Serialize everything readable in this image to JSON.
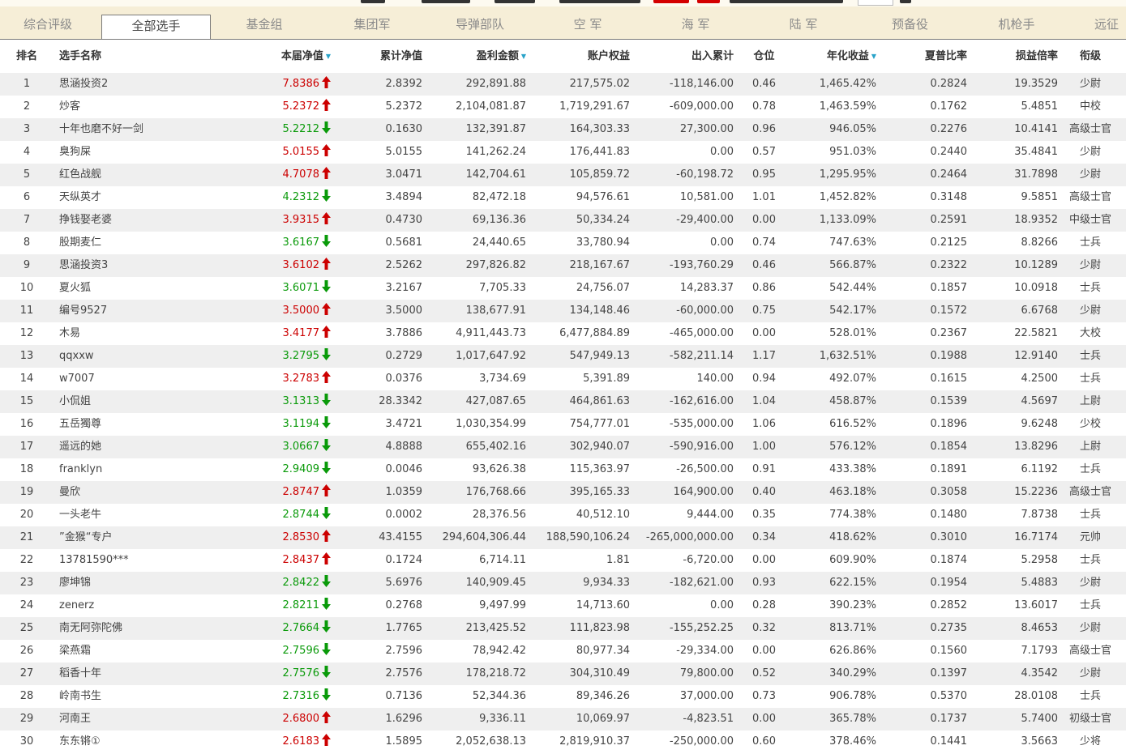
{
  "colors": {
    "up": "#cc0000",
    "down": "#0a9a0a",
    "sort": "#29a3c9",
    "tabbar": "#f6eed7",
    "row_alt": "#efefef"
  },
  "tabs": [
    {
      "label": "综合评级"
    },
    {
      "label": "全部选手",
      "active": true
    },
    {
      "label": "基金组"
    },
    {
      "label": "集团军"
    },
    {
      "label": "导弹部队"
    },
    {
      "label": "空 军"
    },
    {
      "label": "海 军"
    },
    {
      "label": "陆 军"
    },
    {
      "label": "预备役"
    },
    {
      "label": "机枪手"
    },
    {
      "label": "远征"
    }
  ],
  "table": {
    "headers": {
      "rank": "排名",
      "name": "选手名称",
      "nav": "本届净值",
      "cum_nav": "累计净值",
      "profit": "盈利金额",
      "equity": "账户权益",
      "inout": "出入累计",
      "position": "仓位",
      "annual": "年化收益",
      "sharpe": "夏普比率",
      "pl_ratio": "损益倍率",
      "military_rank": "衔级"
    },
    "sort_icon": "triangle-down-icon",
    "rows": [
      {
        "rank": "1",
        "name": "思涵投资2",
        "nav": "7.8386",
        "dir": "up",
        "cum_nav": "2.8392",
        "profit": "292,891.88",
        "equity": "217,575.02",
        "inout": "-118,146.00",
        "position": "0.46",
        "annual": "1,465.42%",
        "sharpe": "0.2824",
        "pl": "19.3529",
        "mrank": "少尉"
      },
      {
        "rank": "2",
        "name": "炒客",
        "nav": "5.2372",
        "dir": "up",
        "cum_nav": "5.2372",
        "profit": "2,104,081.87",
        "equity": "1,719,291.67",
        "inout": "-609,000.00",
        "position": "0.78",
        "annual": "1,463.59%",
        "sharpe": "0.1762",
        "pl": "5.4851",
        "mrank": "中校"
      },
      {
        "rank": "3",
        "name": "十年也磨不好一剑",
        "nav": "5.2212",
        "dir": "down",
        "cum_nav": "0.1630",
        "profit": "132,391.87",
        "equity": "164,303.33",
        "inout": "27,300.00",
        "position": "0.96",
        "annual": "946.05%",
        "sharpe": "0.2276",
        "pl": "10.4141",
        "mrank": "高级士官"
      },
      {
        "rank": "4",
        "name": "臭狗屎",
        "nav": "5.0155",
        "dir": "up",
        "cum_nav": "5.0155",
        "profit": "141,262.24",
        "equity": "176,441.83",
        "inout": "0.00",
        "position": "0.57",
        "annual": "951.03%",
        "sharpe": "0.2440",
        "pl": "35.4841",
        "mrank": "少尉"
      },
      {
        "rank": "5",
        "name": "红色战舰",
        "nav": "4.7078",
        "dir": "up",
        "cum_nav": "3.0471",
        "profit": "142,704.61",
        "equity": "105,859.72",
        "inout": "-60,198.72",
        "position": "0.95",
        "annual": "1,295.95%",
        "sharpe": "0.2464",
        "pl": "31.7898",
        "mrank": "少尉"
      },
      {
        "rank": "6",
        "name": "天纵英才",
        "nav": "4.2312",
        "dir": "down",
        "cum_nav": "3.4894",
        "profit": "82,472.18",
        "equity": "94,576.61",
        "inout": "10,581.00",
        "position": "1.01",
        "annual": "1,452.82%",
        "sharpe": "0.3148",
        "pl": "9.5851",
        "mrank": "高级士官"
      },
      {
        "rank": "7",
        "name": "挣钱娶老婆",
        "nav": "3.9315",
        "dir": "up",
        "cum_nav": "0.4730",
        "profit": "69,136.36",
        "equity": "50,334.24",
        "inout": "-29,400.00",
        "position": "0.00",
        "annual": "1,133.09%",
        "sharpe": "0.2591",
        "pl": "18.9352",
        "mrank": "中级士官"
      },
      {
        "rank": "8",
        "name": "股期麦仁",
        "nav": "3.6167",
        "dir": "down",
        "cum_nav": "0.5681",
        "profit": "24,440.65",
        "equity": "33,780.94",
        "inout": "0.00",
        "position": "0.74",
        "annual": "747.63%",
        "sharpe": "0.2125",
        "pl": "8.8266",
        "mrank": "士兵"
      },
      {
        "rank": "9",
        "name": "思涵投资3",
        "nav": "3.6102",
        "dir": "up",
        "cum_nav": "2.5262",
        "profit": "297,826.82",
        "equity": "218,167.67",
        "inout": "-193,760.29",
        "position": "0.46",
        "annual": "566.87%",
        "sharpe": "0.2322",
        "pl": "10.1289",
        "mrank": "少尉"
      },
      {
        "rank": "10",
        "name": "夏火狐",
        "nav": "3.6071",
        "dir": "down",
        "cum_nav": "3.2167",
        "profit": "7,705.33",
        "equity": "24,756.07",
        "inout": "14,283.37",
        "position": "0.86",
        "annual": "542.44%",
        "sharpe": "0.1857",
        "pl": "10.0918",
        "mrank": "士兵"
      },
      {
        "rank": "11",
        "name": "编号9527",
        "nav": "3.5000",
        "dir": "up",
        "cum_nav": "3.5000",
        "profit": "138,677.91",
        "equity": "134,148.46",
        "inout": "-60,000.00",
        "position": "0.75",
        "annual": "542.17%",
        "sharpe": "0.1572",
        "pl": "6.6768",
        "mrank": "少尉"
      },
      {
        "rank": "12",
        "name": "木易",
        "nav": "3.4177",
        "dir": "up",
        "cum_nav": "3.7886",
        "profit": "4,911,443.73",
        "equity": "6,477,884.89",
        "inout": "-465,000.00",
        "position": "0.00",
        "annual": "528.01%",
        "sharpe": "0.2367",
        "pl": "22.5821",
        "mrank": "大校"
      },
      {
        "rank": "13",
        "name": "qqxxw",
        "nav": "3.2795",
        "dir": "down",
        "cum_nav": "0.2729",
        "profit": "1,017,647.92",
        "equity": "547,949.13",
        "inout": "-582,211.14",
        "position": "1.17",
        "annual": "1,632.51%",
        "sharpe": "0.1988",
        "pl": "12.9140",
        "mrank": "士兵"
      },
      {
        "rank": "14",
        "name": "w7007",
        "nav": "3.2783",
        "dir": "up",
        "cum_nav": "0.0376",
        "profit": "3,734.69",
        "equity": "5,391.89",
        "inout": "140.00",
        "position": "0.94",
        "annual": "492.07%",
        "sharpe": "0.1615",
        "pl": "4.2500",
        "mrank": "士兵"
      },
      {
        "rank": "15",
        "name": "小侃姐",
        "nav": "3.1313",
        "dir": "down",
        "cum_nav": "28.3342",
        "profit": "427,087.65",
        "equity": "464,861.63",
        "inout": "-162,616.00",
        "position": "1.04",
        "annual": "458.87%",
        "sharpe": "0.1539",
        "pl": "4.5697",
        "mrank": "上尉"
      },
      {
        "rank": "16",
        "name": "五岳獨尊",
        "nav": "3.1194",
        "dir": "down",
        "cum_nav": "3.4721",
        "profit": "1,030,354.99",
        "equity": "754,777.01",
        "inout": "-535,000.00",
        "position": "1.06",
        "annual": "616.52%",
        "sharpe": "0.1896",
        "pl": "9.6248",
        "mrank": "少校"
      },
      {
        "rank": "17",
        "name": "遥远的她",
        "nav": "3.0667",
        "dir": "down",
        "cum_nav": "4.8888",
        "profit": "655,402.16",
        "equity": "302,940.07",
        "inout": "-590,916.00",
        "position": "1.00",
        "annual": "576.12%",
        "sharpe": "0.1854",
        "pl": "13.8296",
        "mrank": "上尉"
      },
      {
        "rank": "18",
        "name": "franklyn",
        "nav": "2.9409",
        "dir": "down",
        "cum_nav": "0.0046",
        "profit": "93,626.38",
        "equity": "115,363.97",
        "inout": "-26,500.00",
        "position": "0.91",
        "annual": "433.38%",
        "sharpe": "0.1891",
        "pl": "6.1192",
        "mrank": "士兵"
      },
      {
        "rank": "19",
        "name": "曼欣",
        "nav": "2.8747",
        "dir": "up",
        "cum_nav": "1.0359",
        "profit": "176,768.66",
        "equity": "395,165.33",
        "inout": "164,900.00",
        "position": "0.40",
        "annual": "463.18%",
        "sharpe": "0.3058",
        "pl": "15.2236",
        "mrank": "高级士官"
      },
      {
        "rank": "20",
        "name": "一头老牛",
        "nav": "2.8744",
        "dir": "down",
        "cum_nav": "0.0002",
        "profit": "28,376.56",
        "equity": "40,512.10",
        "inout": "9,444.00",
        "position": "0.35",
        "annual": "774.38%",
        "sharpe": "0.1480",
        "pl": "7.8738",
        "mrank": "士兵"
      },
      {
        "rank": "21",
        "name": "”金猴“专户",
        "nav": "2.8530",
        "dir": "up",
        "cum_nav": "43.4155",
        "profit": "294,604,306.44",
        "equity": "188,590,106.24",
        "inout": "-265,000,000.00",
        "position": "0.34",
        "annual": "418.62%",
        "sharpe": "0.3010",
        "pl": "16.7174",
        "mrank": "元帅"
      },
      {
        "rank": "22",
        "name": "13781590***",
        "nav": "2.8437",
        "dir": "up",
        "cum_nav": "0.1724",
        "profit": "6,714.11",
        "equity": "1.81",
        "inout": "-6,720.00",
        "position": "0.00",
        "annual": "609.90%",
        "sharpe": "0.1874",
        "pl": "5.2958",
        "mrank": "士兵"
      },
      {
        "rank": "23",
        "name": "廖坤锦",
        "nav": "2.8422",
        "dir": "down",
        "cum_nav": "5.6976",
        "profit": "140,909.45",
        "equity": "9,934.33",
        "inout": "-182,621.00",
        "position": "0.93",
        "annual": "622.15%",
        "sharpe": "0.1954",
        "pl": "5.4883",
        "mrank": "少尉"
      },
      {
        "rank": "24",
        "name": "zenerz",
        "nav": "2.8211",
        "dir": "down",
        "cum_nav": "0.2768",
        "profit": "9,497.99",
        "equity": "14,713.60",
        "inout": "0.00",
        "position": "0.28",
        "annual": "390.23%",
        "sharpe": "0.2852",
        "pl": "13.6017",
        "mrank": "士兵"
      },
      {
        "rank": "25",
        "name": "南无阿弥陀佛",
        "nav": "2.7664",
        "dir": "down",
        "cum_nav": "1.7765",
        "profit": "213,425.52",
        "equity": "111,823.98",
        "inout": "-155,252.25",
        "position": "0.32",
        "annual": "813.71%",
        "sharpe": "0.2735",
        "pl": "8.4653",
        "mrank": "少尉"
      },
      {
        "rank": "26",
        "name": "梁燕霜",
        "nav": "2.7596",
        "dir": "down",
        "cum_nav": "2.7596",
        "profit": "78,942.42",
        "equity": "80,977.34",
        "inout": "-29,334.00",
        "position": "0.00",
        "annual": "626.86%",
        "sharpe": "0.1560",
        "pl": "7.1793",
        "mrank": "高级士官"
      },
      {
        "rank": "27",
        "name": "稻香十年",
        "nav": "2.7576",
        "dir": "down",
        "cum_nav": "2.7576",
        "profit": "178,218.72",
        "equity": "304,310.49",
        "inout": "79,800.00",
        "position": "0.52",
        "annual": "340.29%",
        "sharpe": "0.1397",
        "pl": "4.3542",
        "mrank": "少尉"
      },
      {
        "rank": "28",
        "name": "岭南书生",
        "nav": "2.7316",
        "dir": "down",
        "cum_nav": "0.7136",
        "profit": "52,344.36",
        "equity": "89,346.26",
        "inout": "37,000.00",
        "position": "0.73",
        "annual": "906.78%",
        "sharpe": "0.5370",
        "pl": "28.0108",
        "mrank": "士兵"
      },
      {
        "rank": "29",
        "name": "河南王",
        "nav": "2.6800",
        "dir": "up",
        "cum_nav": "1.6296",
        "profit": "9,336.11",
        "equity": "10,069.97",
        "inout": "-4,823.51",
        "position": "0.00",
        "annual": "365.78%",
        "sharpe": "0.1737",
        "pl": "5.7400",
        "mrank": "初级士官"
      },
      {
        "rank": "30",
        "name": "东东锵①",
        "nav": "2.6183",
        "dir": "up",
        "cum_nav": "1.5895",
        "profit": "2,052,638.13",
        "equity": "2,819,910.37",
        "inout": "-250,000.00",
        "position": "0.60",
        "annual": "378.46%",
        "sharpe": "0.1441",
        "pl": "3.5663",
        "mrank": "少将"
      }
    ]
  }
}
